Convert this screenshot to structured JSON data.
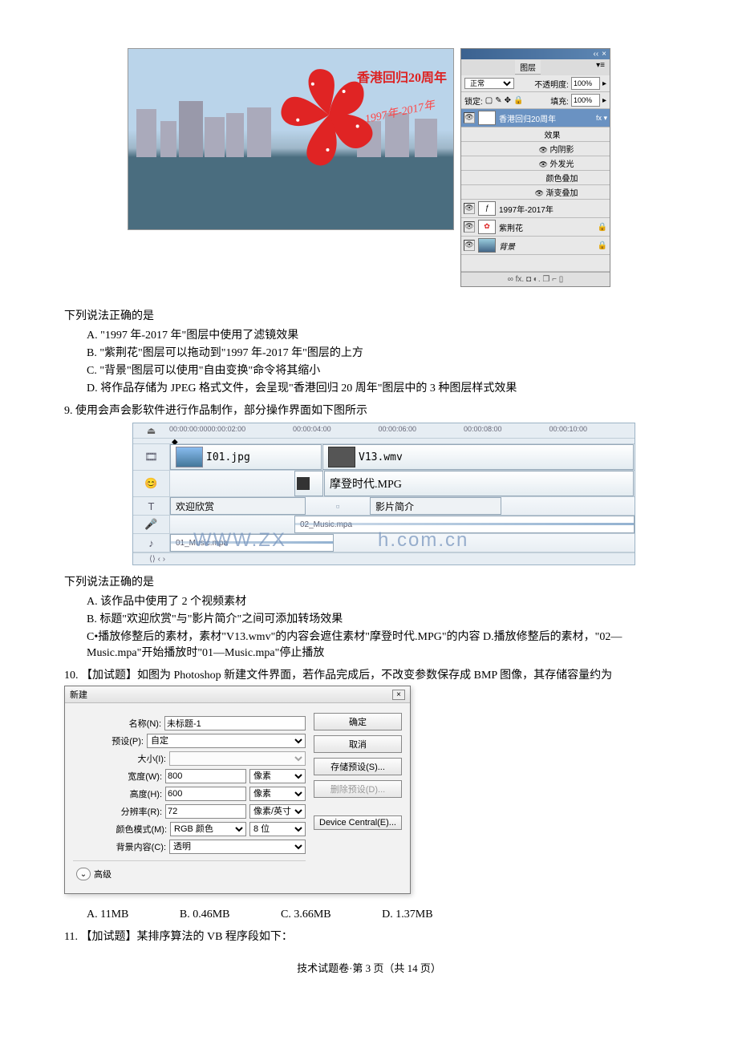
{
  "ps": {
    "hk_title": "香港回归20周年",
    "hk_years": "1997年-2017年",
    "panel_tab": "图层",
    "blend_mode": "正常",
    "opacity_label": "不透明度:",
    "opacity_value": "100%",
    "lock_label": "锁定:",
    "fill_label": "填充:",
    "fill_value": "100%",
    "layers": {
      "l1": "香港回归20周年",
      "fx": "效果",
      "fx1": "内阴影",
      "fx2": "外发光",
      "fx3": "颜色叠加",
      "fx4": "渐变叠加",
      "l2": "1997年-2017年",
      "l3": "紫荆花",
      "l4": "背景"
    },
    "footer_icons": "∞  fx. ◘  ◐. ❐  ⌐  ▯"
  },
  "q8": {
    "lead": "下列说法正确的是",
    "A": "A.  \"1997 年-2017 年\"图层中使用了滤镜效果",
    "B": "B.  \"紫荆花\"图层可以拖动到\"1997 年-2017 年\"图层的上方",
    "C": "C.  \"背景\"图层可以使用\"自由变换\"命令将其缩小",
    "D": "D.    将作品存储为 JPEG 格式文件，会呈现\"香港回归 20 周年\"图层中的 3 种图层样式效果"
  },
  "q9": {
    "num": "9.   使用会声会影软件进行作品制作，部分操作界面如下图所示",
    "time_ticks": [
      "00:00:00:00",
      "00:00:02:00",
      "00:00:04:00",
      "00:00:06:00",
      "00:00:08:00",
      "00:00:10:00"
    ],
    "clip1": "I01.jpg",
    "clip2": "V13.wmv",
    "clip3": "摩登时代.MPG",
    "title1": "欢迎欣赏",
    "title2": "影片简介",
    "audio1": "01_Music.mpa",
    "audio2": "02_Music.mpa",
    "lead": "下列说法正确的是",
    "A": "A.  该作品中使用了 2 个视频素材",
    "B": "B.  标题\"欢迎欣赏\"与\"影片简介\"之间可添加转场效果",
    "C": "C•播放修整后的素材，素材\"V13.wmv\"的内容会遮住素材\"摩登时代.MPG\"的内容 D.播放修整后的素材，\"02—Music.mpa\"开始播放时\"01—Music.mpa\"停止播放"
  },
  "q10": {
    "num": "10. 【加试题】如图为 Photoshop 新建文件界面，若作品完成后，不改变参数保存成 BMP 图像，其存储容量约为",
    "dlg_title": "新建",
    "name_lbl": "名称(N):",
    "name_val": "未标题-1",
    "preset_lbl": "预设(P):",
    "preset_val": "自定",
    "size_lbl": "大小(I):",
    "width_lbl": "宽度(W):",
    "width_val": "800",
    "height_lbl": "高度(H):",
    "height_val": "600",
    "res_lbl": "分辨率(R):",
    "res_val": "72",
    "unit_px": "像素",
    "unit_ppi": "像素/英寸",
    "mode_lbl": "颜色模式(M):",
    "mode_val": "RGB 颜色",
    "bit_val": "8 位",
    "bg_lbl": "背景内容(C):",
    "bg_val": "透明",
    "adv": "高级",
    "btn_ok": "确定",
    "btn_cancel": "取消",
    "btn_save": "存储预设(S)...",
    "btn_del": "删除预设(D)...",
    "btn_dev": "Device Central(E)...",
    "ansA": "A. 11MB",
    "ansB": "B. 0.46MB",
    "ansC": "C. 3.66MB",
    "ansD": "D. 1.37MB"
  },
  "q11": {
    "num": "11. 【加试题】某排序算法的 VB 程序段如下："
  },
  "footer": "技术试题卷·第 3 页（共 14 页）"
}
